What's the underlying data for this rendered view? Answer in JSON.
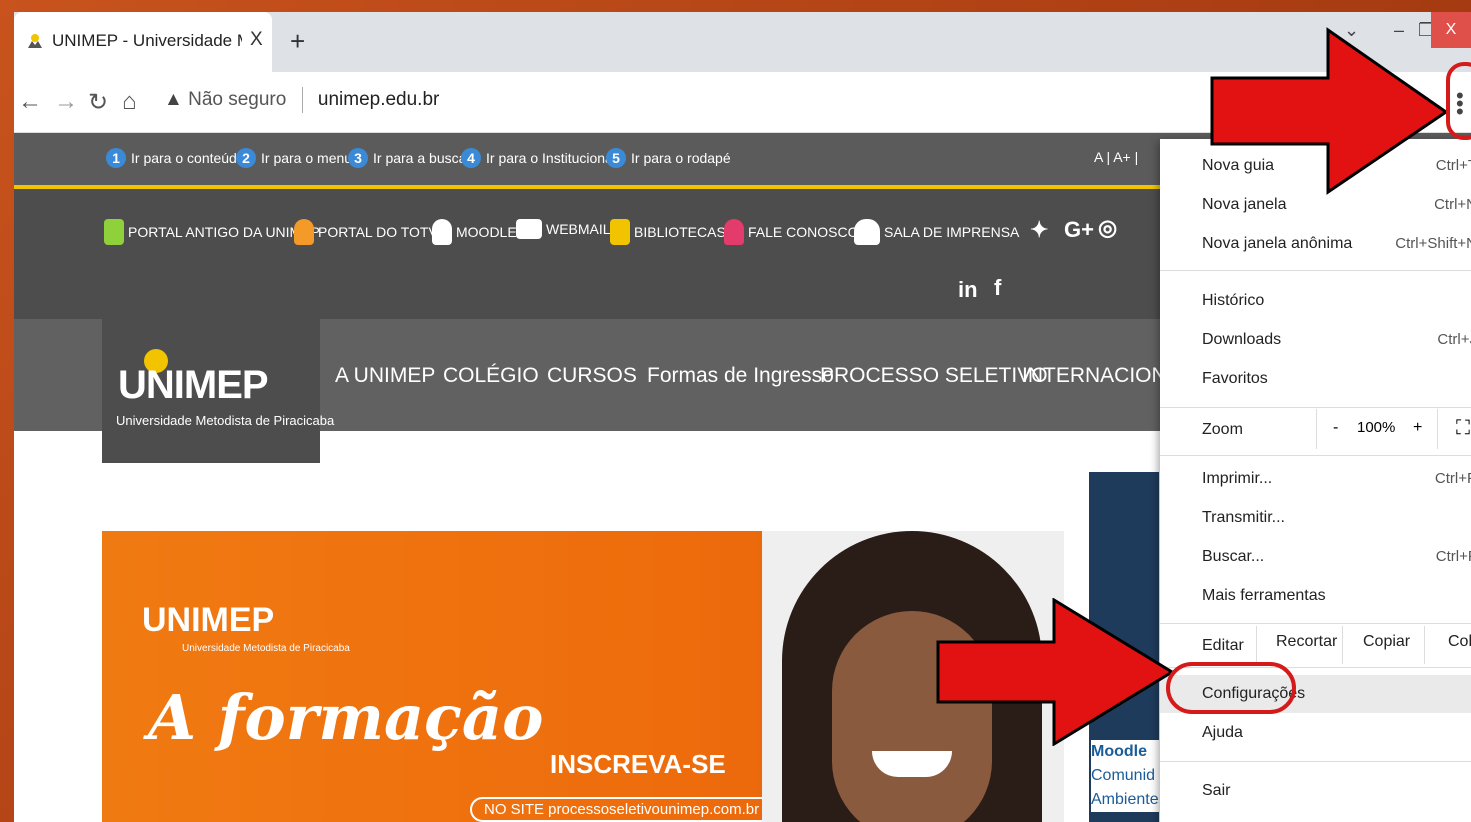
{
  "browser": {
    "tab_title": "UNIMEP - Universidade Metodist",
    "tab_close": "X",
    "new_tab": "+",
    "window_close": "X",
    "security_label": "Não seguro",
    "url": "unimep.edu.br"
  },
  "site": {
    "skip_links": [
      {
        "num": "1",
        "label": "Ir para o conteúdo"
      },
      {
        "num": "2",
        "label": "Ir para o menu"
      },
      {
        "num": "3",
        "label": "Ir para a busca"
      },
      {
        "num": "4",
        "label": "Ir para o Institucional"
      },
      {
        "num": "5",
        "label": "Ir para o rodapé"
      }
    ],
    "font_controls": "A |   A+ |",
    "portal_links": [
      "PORTAL ANTIGO DA UNIMEP",
      "PORTAL DO TOTVS",
      "MOODLE",
      "WEBMAIL",
      "BIBLIOTECAS",
      "FALE CONOSCO",
      "SALA DE IMPRENSA"
    ],
    "social": {
      "twitter": "𝕪",
      "gplus": "G+",
      "instagram": "◎",
      "linkedin": "in",
      "facebook": "f"
    },
    "logo": {
      "brand": "UNIMEP",
      "subtitle": "Universidade Metodista de Piracicaba"
    },
    "menu": [
      "A UNIMEP",
      "COLÉGIO",
      "CURSOS",
      "Formas de Ingresso",
      "PROCESSO SELETIVO",
      "INTERNACIONAL"
    ],
    "banner": {
      "logo": "UNIMEP",
      "logo_sub": "Universidade Metodista de Piracicaba",
      "headline": "A formação",
      "cta": "INSCREVA-SE",
      "site": "NO SITE  processoseletivounimep.com.br"
    },
    "side_card": {
      "line1": "Moodle",
      "line2": "Comunid",
      "line3": "Ambiente Virtual de Aprendizagem"
    }
  },
  "chrome_menu": {
    "items": [
      {
        "label": "Nova guia",
        "shortcut": "Ctrl+T"
      },
      {
        "label": "Nova janela",
        "shortcut": "Ctrl+N"
      },
      {
        "label": "Nova janela anônima",
        "shortcut": "Ctrl+Shift+N"
      },
      {
        "label": "Histórico",
        "shortcut": ""
      },
      {
        "label": "Downloads",
        "shortcut": "Ctrl+J"
      },
      {
        "label": "Favoritos",
        "shortcut": ""
      },
      {
        "label": "Imprimir...",
        "shortcut": "Ctrl+P"
      },
      {
        "label": "Transmitir...",
        "shortcut": ""
      },
      {
        "label": "Buscar...",
        "shortcut": "Ctrl+F"
      },
      {
        "label": "Mais ferramentas",
        "shortcut": ""
      },
      {
        "label": "Configurações",
        "shortcut": ""
      },
      {
        "label": "Ajuda",
        "shortcut": ""
      },
      {
        "label": "Sair",
        "shortcut": ""
      }
    ],
    "zoom": {
      "label": "Zoom",
      "minus": "-",
      "value": "100%",
      "plus": "+"
    },
    "edit": {
      "label": "Editar",
      "cut": "Recortar",
      "copy": "Copiar",
      "paste": "Colar"
    }
  },
  "colors": {
    "accent_yellow": "#f2c400",
    "annotation_red": "#e31212",
    "site_dark": "#4d4d4d"
  }
}
